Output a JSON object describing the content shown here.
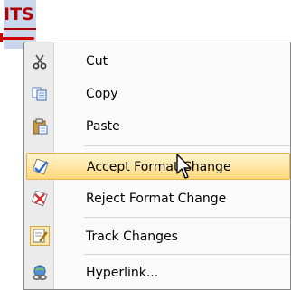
{
  "document": {
    "selected_word": "ITS"
  },
  "context_menu": {
    "items": [
      {
        "label": "Cut",
        "icon": "scissors-icon",
        "highlighted": false
      },
      {
        "label": "Copy",
        "icon": "copy-icon",
        "highlighted": false
      },
      {
        "label": "Paste",
        "icon": "clipboard-icon",
        "highlighted": false
      },
      {
        "label": "Accept Format Change",
        "icon": "accept-change-icon",
        "highlighted": true
      },
      {
        "label": "Reject Format Change",
        "icon": "reject-change-icon",
        "highlighted": false
      },
      {
        "label": "Track Changes",
        "icon": "track-changes-icon",
        "highlighted": false
      },
      {
        "label": "Hyperlink...",
        "icon": "hyperlink-icon",
        "highlighted": false
      }
    ]
  },
  "colors": {
    "highlight": "#ffd97a",
    "word_red": "#b20000",
    "selection": "#c9d6ec"
  }
}
